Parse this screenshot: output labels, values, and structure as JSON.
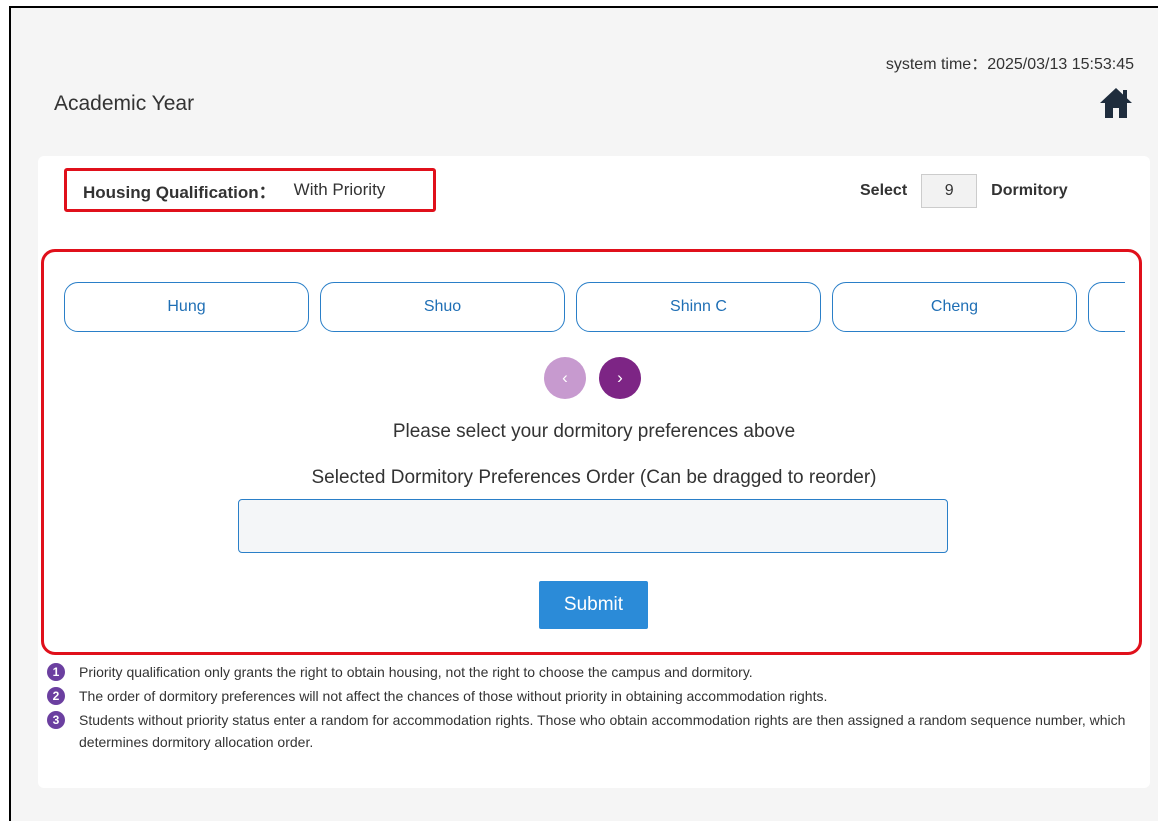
{
  "header": {
    "system_time": "system time：2025/03/13 15:53:45",
    "page_title": "Academic Year",
    "home_icon": "home-icon"
  },
  "qualification": {
    "label": "Housing Qualification：",
    "value": "With Priority"
  },
  "select_count": {
    "prefix": "Select",
    "value": "9",
    "suffix": "Dormitory"
  },
  "dormitories": [
    "Hung",
    "Shuo",
    "Shinn C",
    "Cheng",
    ""
  ],
  "nav": {
    "prev": "‹",
    "next": "›"
  },
  "instructions": {
    "select_prompt": "Please select your dormitory preferences above",
    "order_label": "Selected Dormitory Preferences Order (Can be dragged to reorder)"
  },
  "submit_label": "Submit",
  "notes": [
    {
      "num": "1",
      "text": "Priority qualification only grants the right to obtain housing, not the right to choose the campus and dormitory."
    },
    {
      "num": "2",
      "text": "The order of dormitory preferences will not affect the chances of those without priority in obtaining accommodation rights."
    },
    {
      "num": "3",
      "text": "Students without priority status enter a random for accommodation rights. Those who obtain accommodation rights are then assigned a random sequence number, which determines dormitory allocation order."
    }
  ],
  "colors": {
    "highlight_border": "#e0101b",
    "accent_blue": "#2b8bd8",
    "nav_purple": "#7d2585",
    "note_badge": "#6b3fa0"
  }
}
